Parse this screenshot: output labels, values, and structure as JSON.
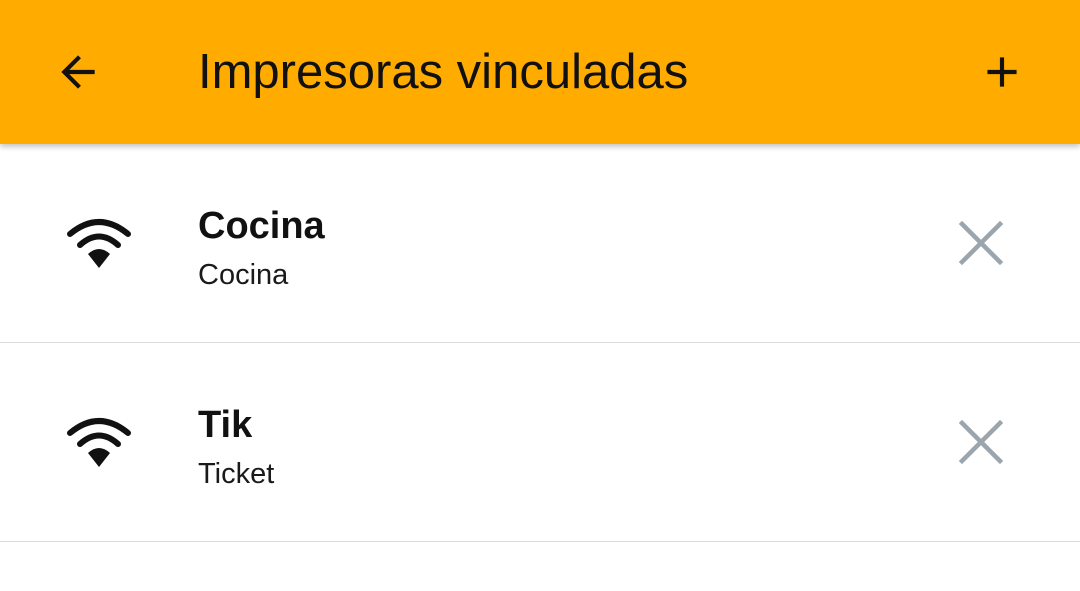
{
  "app_bar": {
    "title": "Impresoras vinculadas",
    "back_icon": "arrow-back-icon",
    "add_icon": "plus-icon",
    "background_color": "#FFAB00"
  },
  "printers": [
    {
      "name": "Cocina",
      "description": "Cocina",
      "icon": "wifi-icon",
      "remove_icon": "close-icon"
    },
    {
      "name": "Tik",
      "description": "Ticket",
      "icon": "wifi-icon",
      "remove_icon": "close-icon"
    }
  ],
  "colors": {
    "accent": "#FFAB00",
    "remove_icon": "#9aa5ad",
    "divider": "#dcdcdc"
  }
}
